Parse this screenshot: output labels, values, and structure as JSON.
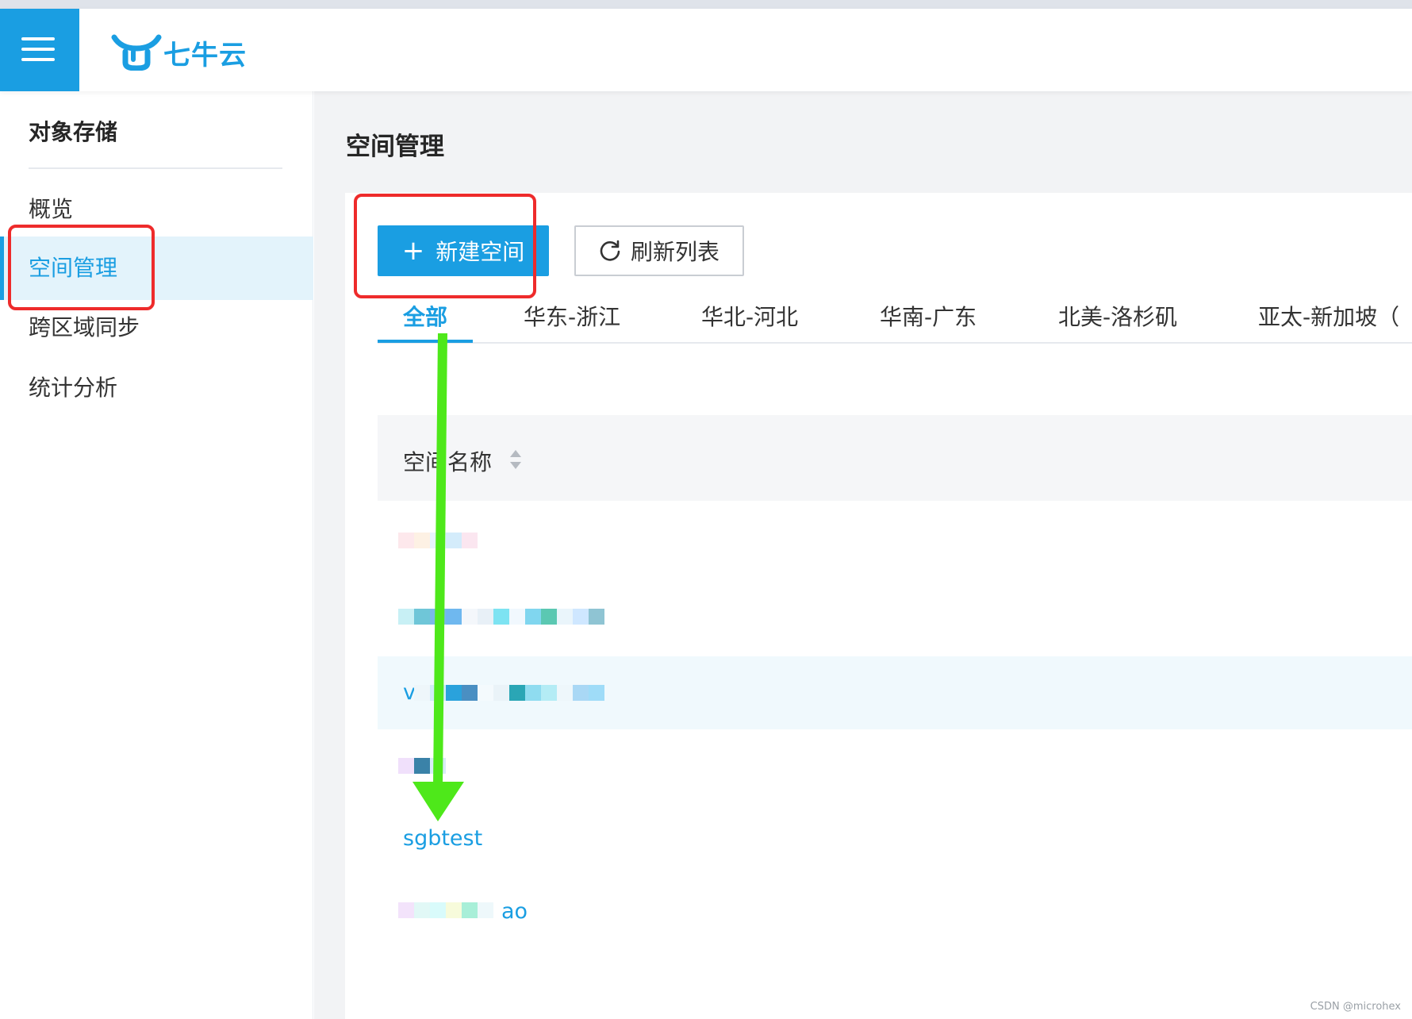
{
  "brand": {
    "name": "七牛云",
    "color": "#1a9ee2"
  },
  "topbar": {
    "menu_icon": "hamburger-menu-icon",
    "logo_icon": "qiniu-bull-logo-icon"
  },
  "sidebar": {
    "title": "对象存储",
    "items": [
      {
        "label": "概览",
        "active": false
      },
      {
        "label": "空间管理",
        "active": true
      },
      {
        "label": "跨区域同步",
        "active": false
      },
      {
        "label": "统计分析",
        "active": false
      }
    ]
  },
  "main": {
    "title": "空间管理",
    "toolbar": {
      "new_bucket_label": "新建空间",
      "new_bucket_icon": "plus-icon",
      "refresh_label": "刷新列表",
      "refresh_icon": "refresh-icon"
    },
    "tabs": [
      {
        "label": "全部",
        "active": true
      },
      {
        "label": "华东-浙江",
        "active": false
      },
      {
        "label": "华北-河北",
        "active": false
      },
      {
        "label": "华南-广东",
        "active": false
      },
      {
        "label": "北美-洛杉矶",
        "active": false
      },
      {
        "label": "亚太-新加坡（",
        "active": false
      }
    ],
    "table": {
      "columns": [
        {
          "label": "空间名称",
          "sortable": true,
          "sort_icon": "sort-arrows-icon"
        }
      ],
      "rows": [
        {
          "name": "",
          "obscured": true
        },
        {
          "name": "",
          "obscured": true
        },
        {
          "name": "v",
          "obscured": true,
          "hovered": true
        },
        {
          "name": "",
          "obscured": true
        },
        {
          "name": "sgbtest",
          "obscured": false
        },
        {
          "name": "ao",
          "obscured": true
        }
      ]
    }
  },
  "annotations": {
    "highlight_color": "#ee2b2b",
    "arrow_color": "#4ee81a"
  },
  "watermark": "CSDN @microhex"
}
